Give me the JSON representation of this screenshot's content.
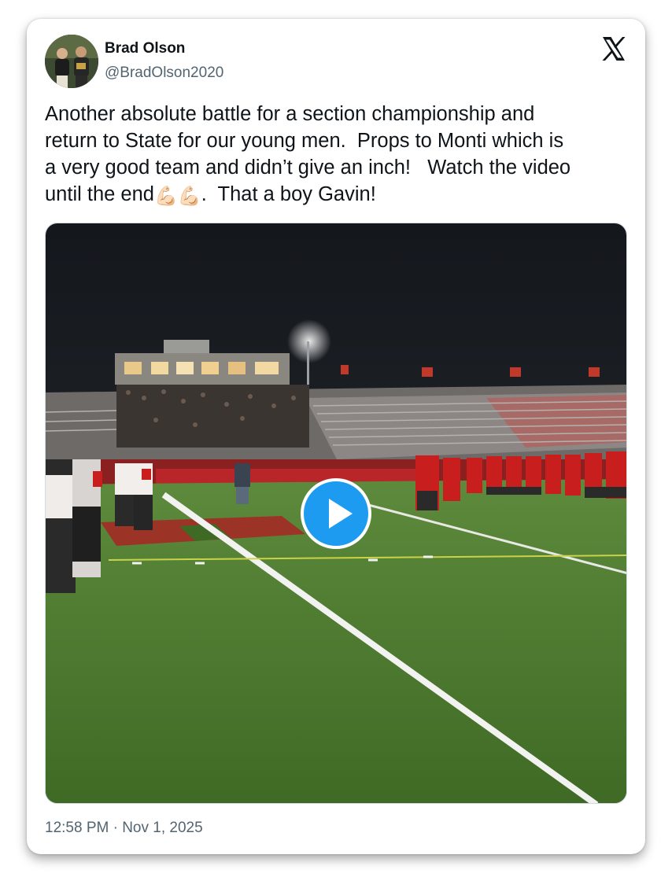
{
  "tweet": {
    "author_name": "Brad Olson",
    "author_handle": "@BradOlson2020",
    "text_line1": "Another absolute battle for a section championship and",
    "text_line2": "return to State for our young men.  Props to Monti which is",
    "text_line3": "a very good team and didn’t give an inch!   Watch the video",
    "text_line4_a": "until the end",
    "text_line4_emoji": "💪🏻💪🏻",
    "text_line4_b": ".  That a boy Gavin!",
    "timestamp": "12:58 PM · Nov 1, 2025"
  },
  "icons": {
    "platform_logo": "x-logo-icon",
    "play": "play-icon",
    "avatar": "avatar-image"
  },
  "colors": {
    "text_primary": "#0f1419",
    "text_secondary": "#536471",
    "play_button": "#1d9bf0",
    "field_green": "#4f7a2f",
    "team_red": "#c81e1e"
  }
}
